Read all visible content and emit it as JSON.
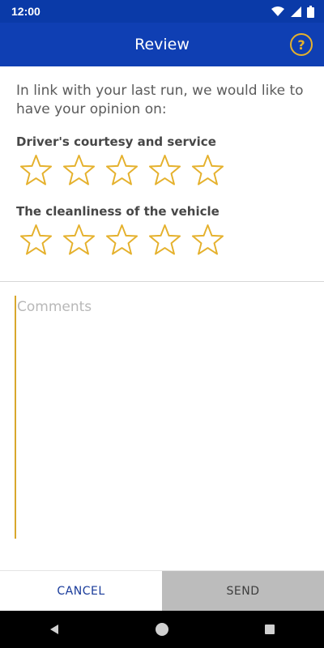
{
  "status_bar": {
    "time": "12:00",
    "icons": [
      "wifi-icon",
      "cellular-signal-icon",
      "battery-icon"
    ]
  },
  "app_bar": {
    "title": "Review",
    "help_icon": "question-mark-circle-icon",
    "help_symbol": "?"
  },
  "intro": {
    "text": "In link with your last run, we would like to have your opinion on:"
  },
  "ratings": [
    {
      "label": "Driver's courtesy and service",
      "value": 0,
      "max": 5
    },
    {
      "label": "The cleanliness of the vehicle",
      "value": 0,
      "max": 5
    }
  ],
  "comments": {
    "value": "",
    "placeholder": "Comments"
  },
  "actions": {
    "cancel_label": "CANCEL",
    "send_label": "SEND"
  },
  "navigation": {
    "back_icon": "back-triangle-icon",
    "home_icon": "home-circle-icon",
    "recents_icon": "recents-square-icon"
  },
  "colors": {
    "primary": "#0f3fb3",
    "status_bar": "#0a3aa8",
    "accent": "#e5b12d",
    "cancel_text": "#183a9a",
    "send_background": "#bcbcbc",
    "nav_bar": "#000000"
  }
}
